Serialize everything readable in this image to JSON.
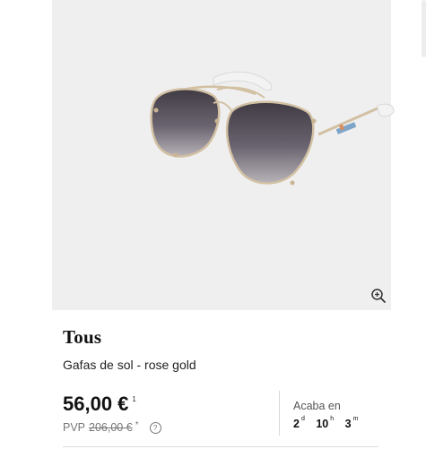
{
  "product": {
    "brand": "Tous",
    "name": "Gafas de sol - rose gold",
    "image_icon": "sunglasses-image"
  },
  "price": {
    "current": "56,00 €",
    "current_sup": "1",
    "pvp_label": "PVP",
    "pvp_old": "206,00 €",
    "pvp_asterisk": "*",
    "help_icon": "question-icon"
  },
  "countdown": {
    "label": "Acaba en",
    "days": "2",
    "days_unit": "d",
    "hours": "10",
    "hours_unit": "h",
    "minutes": "3",
    "minutes_unit": "m"
  },
  "controls": {
    "zoom_icon": "zoom-in-icon"
  },
  "colors": {
    "image_bg": "#efefef",
    "lens": "#5e5660",
    "frame": "#d6c4a8",
    "temple_tip": "#f3f3f3"
  }
}
